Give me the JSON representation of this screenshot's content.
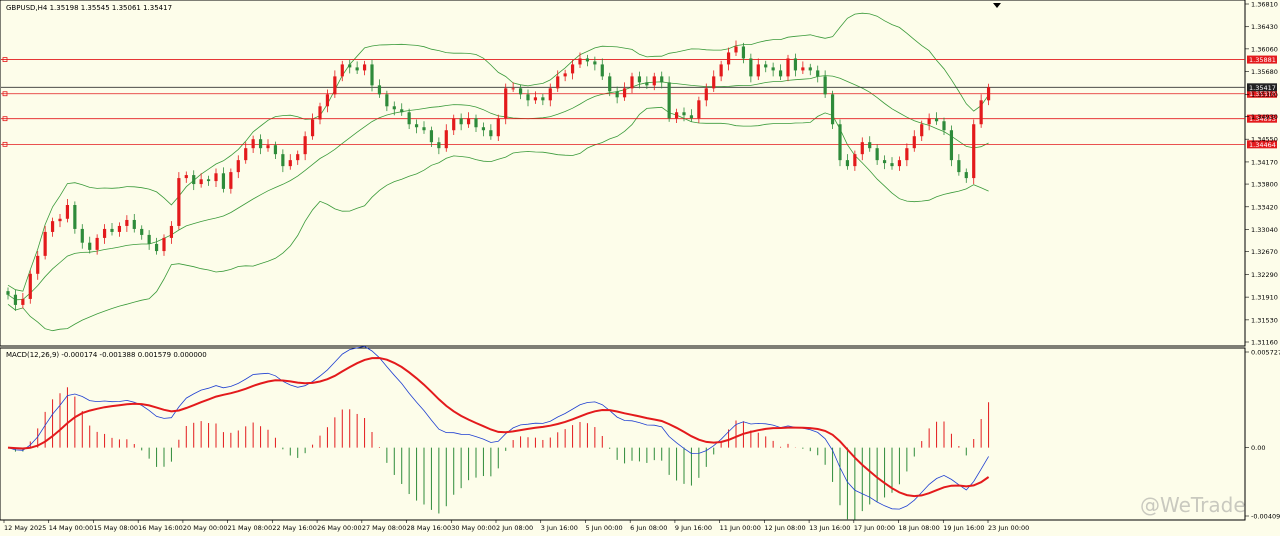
{
  "chart_data": [
    {
      "type": "candlestick",
      "title": "GBPUSD,H4  1.35198 1.35545 1.35061 1.35417",
      "symbol": "GBPUSD",
      "timeframe": "H4",
      "ohlc_header": {
        "open": 1.35198,
        "high": 1.35545,
        "low": 1.35061,
        "close": 1.35417
      },
      "ylim": [
        1.3116,
        1.3681
      ],
      "y_ticks": [
        "1.36810",
        "1.36430",
        "1.36060",
        "1.35680",
        "1.35300",
        "1.34930",
        "1.34550",
        "1.34170",
        "1.33800",
        "1.33420",
        "1.33040",
        "1.32670",
        "1.32290",
        "1.31910",
        "1.31530",
        "1.31160"
      ],
      "x_ticks": [
        "12 May 2025",
        "14 May 00:00",
        "15 May 08:00",
        "16 May 16:00",
        "20 May 00:00",
        "21 May 08:00",
        "22 May 16:00",
        "26 May 00:00",
        "27 May 08:00",
        "28 May 16:00",
        "30 May 00:00",
        "2 Jun 08:00",
        "3 Jun 16:00",
        "5 Jun 00:00",
        "6 Jun 08:00",
        "9 Jun 16:00",
        "11 Jun 00:00",
        "12 Jun 08:00",
        "13 Jun 16:00",
        "17 Jun 00:00",
        "18 Jun 08:00",
        "19 Jun 16:00",
        "23 Jun 00:00"
      ],
      "closes": [
        1.3195,
        1.3178,
        1.3188,
        1.323,
        1.326,
        1.33,
        1.3318,
        1.3322,
        1.3345,
        1.3305,
        1.3282,
        1.327,
        1.329,
        1.3305,
        1.33,
        1.331,
        1.332,
        1.3305,
        1.3295,
        1.328,
        1.3268,
        1.329,
        1.331,
        1.339,
        1.3395,
        1.338,
        1.3388,
        1.3385,
        1.3398,
        1.3372,
        1.34,
        1.342,
        1.344,
        1.3455,
        1.344,
        1.3445,
        1.343,
        1.341,
        1.342,
        1.343,
        1.346,
        1.3488,
        1.351,
        1.353,
        1.356,
        1.358,
        1.3575,
        1.357,
        1.358,
        1.3545,
        1.353,
        1.351,
        1.3505,
        1.35,
        1.348,
        1.3475,
        1.347,
        1.345,
        1.344,
        1.347,
        1.349,
        1.348,
        1.349,
        1.3475,
        1.347,
        1.346,
        1.349,
        1.354,
        1.354,
        1.353,
        1.352,
        1.3525,
        1.352,
        1.354,
        1.356,
        1.3565,
        1.358,
        1.359,
        1.3585,
        1.358,
        1.356,
        1.3535,
        1.3525,
        1.354,
        1.356,
        1.355,
        1.3545,
        1.356,
        1.355,
        1.349,
        1.35,
        1.3495,
        1.349,
        1.352,
        1.354,
        1.356,
        1.358,
        1.36,
        1.361,
        1.359,
        1.356,
        1.358,
        1.3575,
        1.357,
        1.356,
        1.359,
        1.357,
        1.3575,
        1.357,
        1.356,
        1.353,
        1.348,
        1.342,
        1.341,
        1.343,
        1.345,
        1.344,
        1.342,
        1.3415,
        1.341,
        1.342,
        1.344,
        1.346,
        1.348,
        1.349,
        1.3485,
        1.347,
        1.342,
        1.34,
        1.339,
        1.348,
        1.352,
        1.35417
      ],
      "resistance_levels": [
        "1.35310",
        "1.35881",
        "1.35417",
        "1.34893",
        "1.34464"
      ],
      "current_price": "1.35417",
      "colors": {
        "up": "#e31a1c",
        "down": "#2e8b3a",
        "bands": "#3a9a3a",
        "level": "#e31a1c",
        "current": "#333333"
      }
    },
    {
      "type": "macd",
      "title": "MACD(12,26,9) -0.000174 -0.001388 0.001579 0.000000",
      "ylim": [
        -0.004094,
        0.005727
      ],
      "y_ticks": [
        "0.005727",
        "0.00",
        "-0.004094"
      ],
      "colors": {
        "macd": "#1f3fd1",
        "signal": "#e31a1c",
        "hist_pos": "#e31a1c",
        "hist_neg": "#2e8b3a"
      }
    }
  ],
  "watermark": "@WeTrade"
}
